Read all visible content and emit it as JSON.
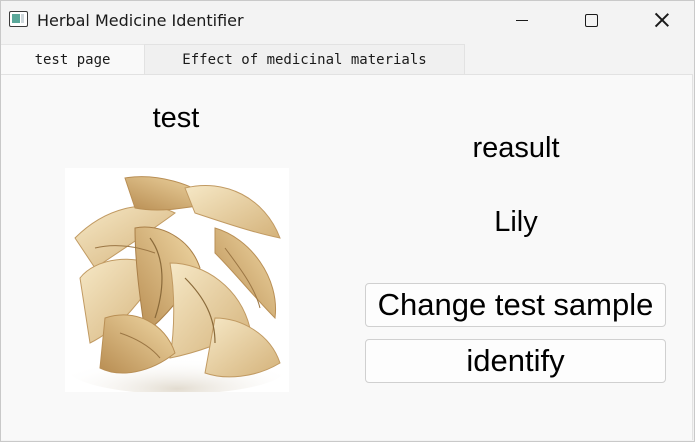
{
  "window": {
    "title": "Herbal Medicine Identifier"
  },
  "tabs": [
    {
      "label": "test page",
      "active": true
    },
    {
      "label": "Effect of medicinal materials",
      "active": false
    }
  ],
  "test_page": {
    "heading": "test",
    "result_heading": "reasult",
    "result_value": "Lily",
    "sample_image": "dried lily bulb slices",
    "change_button_label": "Change test sample",
    "identify_button_label": "identify"
  },
  "colors": {
    "window_bg": "#f3f3f3",
    "panel_bg": "#f9f9f9",
    "button_border": "#d0d0d0",
    "herb_light": "#f2dfb4",
    "herb_dark": "#c9a46a"
  }
}
